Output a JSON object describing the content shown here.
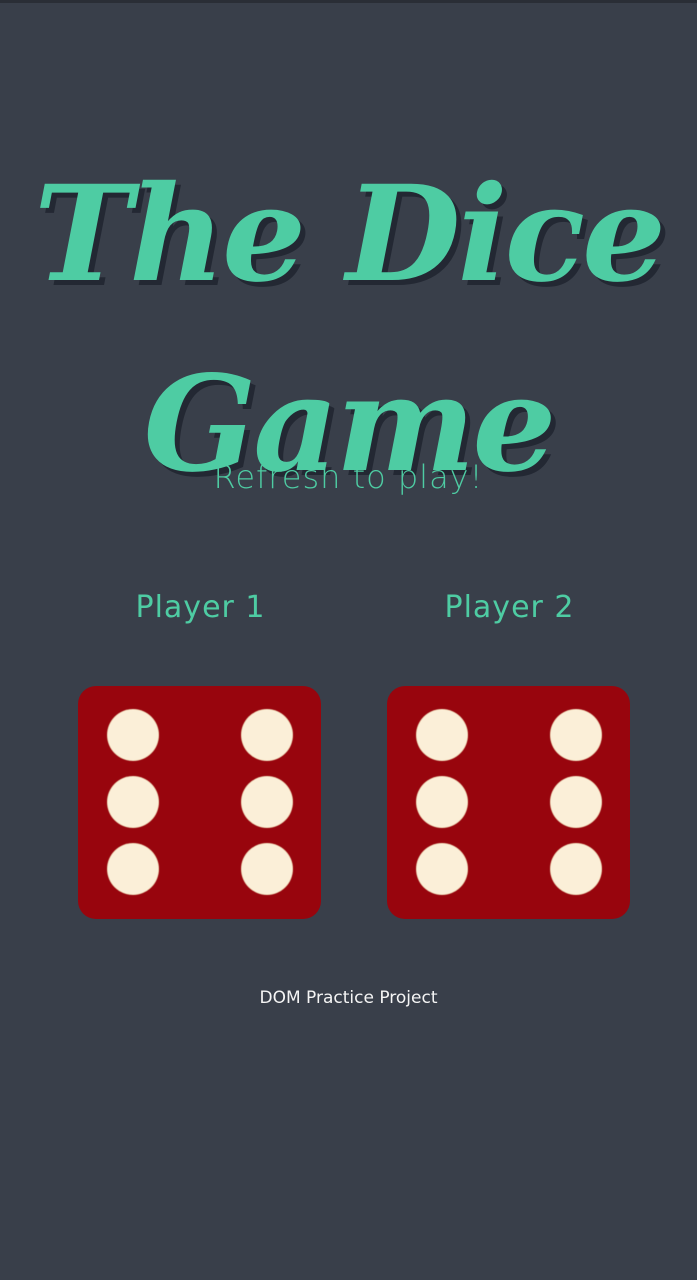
{
  "title": {
    "line1": "The Dice",
    "line2": "Game"
  },
  "subtitle": "Refresh to play!",
  "players": [
    {
      "label": "Player 1",
      "die_value": 6
    },
    {
      "label": "Player 2",
      "die_value": 6
    }
  ],
  "footer": "DOM Practice Project",
  "colors": {
    "background": "#393f4a",
    "accent": "#4ecca3",
    "die": "#98050d",
    "pip": "#fbefd8",
    "footer_text": "#f5f5f5"
  }
}
